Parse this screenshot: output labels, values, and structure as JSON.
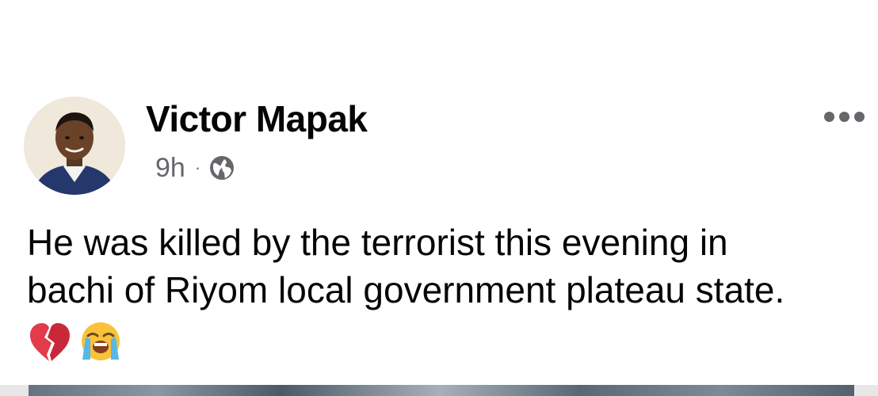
{
  "post": {
    "author_name": "Victor Mapak",
    "timestamp": "9h",
    "separator": "·",
    "audience_icon": "globe-icon",
    "more_icon": "more-options-icon",
    "text_line1": "He was killed by the terrorist this evening in",
    "text_line2": "bachi of Riyom local government plateau state.",
    "emojis": [
      "broken-heart-emoji",
      "loudly-crying-face-emoji"
    ]
  }
}
